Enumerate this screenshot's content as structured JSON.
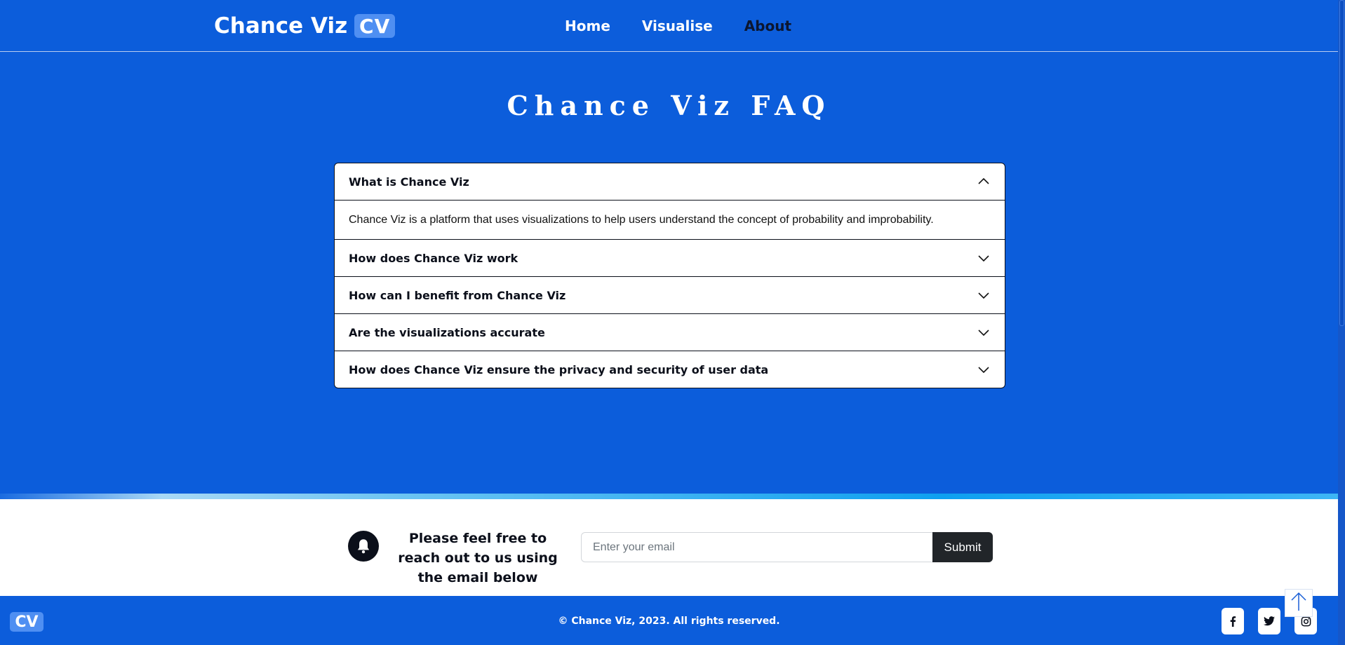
{
  "navbar": {
    "brand_name": "Chance Viz",
    "brand_badge": "CV",
    "links": [
      {
        "label": "Home"
      },
      {
        "label": "Visualise"
      },
      {
        "label": "About"
      }
    ]
  },
  "faq": {
    "title": "Chance Viz FAQ",
    "items": [
      {
        "question": "What is Chance Viz",
        "answer": "Chance Viz is a platform that uses visualizations to help users understand the concept of probability and improbability.",
        "expanded": true
      },
      {
        "question": "How does Chance Viz work",
        "expanded": false
      },
      {
        "question": "How can I benefit from Chance Viz",
        "expanded": false
      },
      {
        "question": "Are the visualizations accurate",
        "expanded": false
      },
      {
        "question": "How does Chance Viz ensure the privacy and security of user data",
        "expanded": false
      }
    ]
  },
  "contact": {
    "text": "Please feel free to reach out to us using the email below",
    "email_placeholder": "Enter your email",
    "submit_label": "Submit"
  },
  "footer": {
    "badge": "CV",
    "copyright": "© Chance Viz, 2023. All rights reserved.",
    "socials": [
      {
        "icon": "facebook-icon",
        "glyph": "f"
      },
      {
        "icon": "twitter-icon",
        "glyph": "🐦"
      },
      {
        "icon": "instagram-icon",
        "glyph": "◎"
      }
    ]
  },
  "colors": {
    "primary": "#0c5ddb",
    "brand_badge": "#4f8ff2",
    "dark": "#212529"
  }
}
